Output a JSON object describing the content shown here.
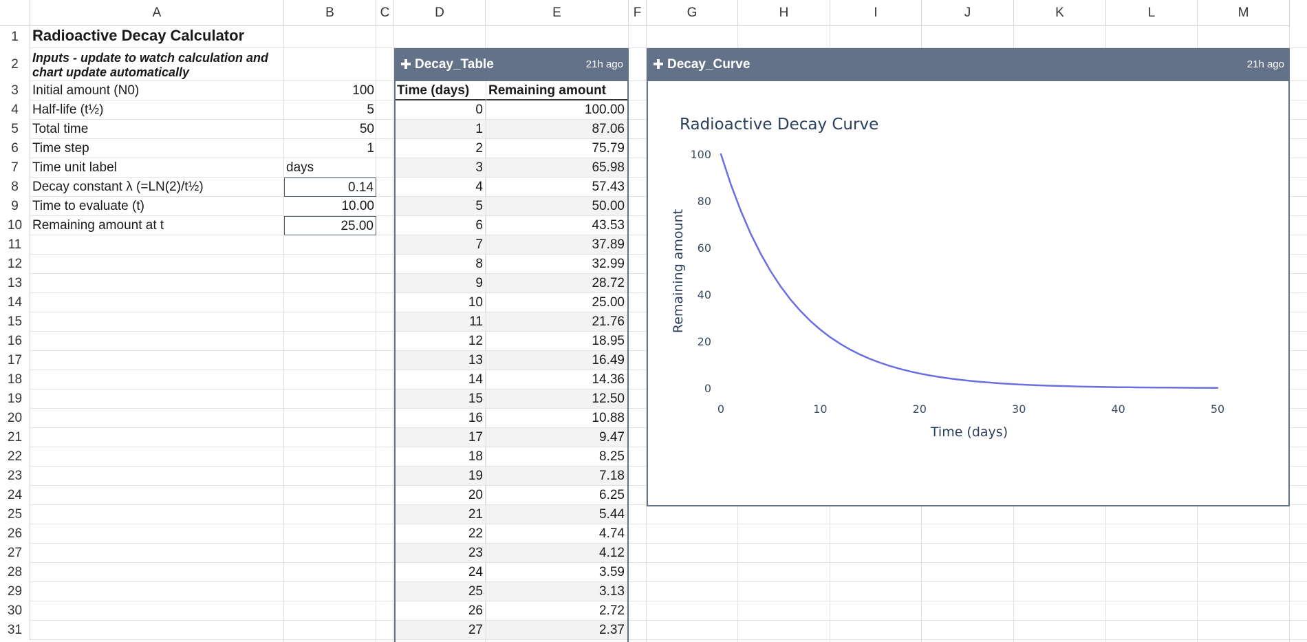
{
  "columns": [
    "A",
    "B",
    "C",
    "D",
    "E",
    "F",
    "G",
    "H",
    "I",
    "J",
    "K",
    "L",
    "M"
  ],
  "rows": [
    "1",
    "2",
    "3",
    "4",
    "5",
    "6",
    "7",
    "8",
    "9",
    "10",
    "11",
    "12",
    "13",
    "14",
    "15",
    "16",
    "17",
    "18",
    "19",
    "20",
    "21",
    "22",
    "23",
    "24",
    "25",
    "26",
    "27",
    "28",
    "29",
    "30",
    "31"
  ],
  "calculator": {
    "title": "Radioactive Decay Calculator",
    "note": "Inputs - update to watch calculation and chart update automatically",
    "params": [
      {
        "label": "Initial amount (N0)",
        "value": "100"
      },
      {
        "label": "Half-life (t½)",
        "value": "5"
      },
      {
        "label": "Total time",
        "value": "50"
      },
      {
        "label": "Time step",
        "value": "1"
      },
      {
        "label": "Time unit label",
        "value": "days"
      },
      {
        "label": "Decay constant λ (=LN(2)/t½)",
        "value": "0.14"
      },
      {
        "label": "Time to evaluate (t)",
        "value": "10.00"
      },
      {
        "label": "Remaining amount at t",
        "value": "25.00"
      }
    ]
  },
  "decay_table": {
    "name": "Decay_Table",
    "updated": "21h ago",
    "headers": [
      "Time (days)",
      "Remaining amount"
    ],
    "rows": [
      [
        "0",
        "100.00"
      ],
      [
        "1",
        "87.06"
      ],
      [
        "2",
        "75.79"
      ],
      [
        "3",
        "65.98"
      ],
      [
        "4",
        "57.43"
      ],
      [
        "5",
        "50.00"
      ],
      [
        "6",
        "43.53"
      ],
      [
        "7",
        "37.89"
      ],
      [
        "8",
        "32.99"
      ],
      [
        "9",
        "28.72"
      ],
      [
        "10",
        "25.00"
      ],
      [
        "11",
        "21.76"
      ],
      [
        "12",
        "18.95"
      ],
      [
        "13",
        "16.49"
      ],
      [
        "14",
        "14.36"
      ],
      [
        "15",
        "12.50"
      ],
      [
        "16",
        "10.88"
      ],
      [
        "17",
        "9.47"
      ],
      [
        "18",
        "8.25"
      ],
      [
        "19",
        "7.18"
      ],
      [
        "20",
        "6.25"
      ],
      [
        "21",
        "5.44"
      ],
      [
        "22",
        "4.74"
      ],
      [
        "23",
        "4.12"
      ],
      [
        "24",
        "3.59"
      ],
      [
        "25",
        "3.13"
      ],
      [
        "26",
        "2.72"
      ],
      [
        "27",
        "2.37"
      ]
    ]
  },
  "decay_curve": {
    "name": "Decay_Curve",
    "updated": "21h ago"
  },
  "colors": {
    "header_bg": "#647289",
    "line": "#6a6ee0",
    "axis_text": "#2b3f5c"
  },
  "chart_data": {
    "type": "line",
    "title": "Radioactive Decay Curve",
    "xlabel": "Time (days)",
    "ylabel": "Remaining amount",
    "xlim": [
      0,
      50
    ],
    "ylim": [
      0,
      100
    ],
    "xticks": [
      0,
      10,
      20,
      30,
      40,
      50
    ],
    "yticks": [
      0,
      20,
      40,
      60,
      80,
      100
    ],
    "grid": false,
    "x": [
      0,
      1,
      2,
      3,
      4,
      5,
      6,
      7,
      8,
      9,
      10,
      11,
      12,
      13,
      14,
      15,
      16,
      17,
      18,
      19,
      20,
      21,
      22,
      23,
      24,
      25,
      26,
      27,
      28,
      29,
      30,
      31,
      32,
      33,
      34,
      35,
      36,
      37,
      38,
      39,
      40,
      41,
      42,
      43,
      44,
      45,
      46,
      47,
      48,
      49,
      50
    ],
    "series": [
      {
        "values": [
          100.0,
          87.06,
          75.79,
          65.98,
          57.43,
          50.0,
          43.53,
          37.89,
          32.99,
          28.72,
          25.0,
          21.76,
          18.95,
          16.49,
          14.36,
          12.5,
          10.88,
          9.47,
          8.25,
          7.18,
          6.25,
          5.44,
          4.74,
          4.12,
          3.59,
          3.13,
          2.72,
          2.37,
          2.06,
          1.8,
          1.56,
          1.36,
          1.18,
          1.03,
          0.9,
          0.78,
          0.68,
          0.59,
          0.52,
          0.45,
          0.39,
          0.34,
          0.3,
          0.26,
          0.22,
          0.2,
          0.17,
          0.15,
          0.13,
          0.11,
          0.1
        ]
      }
    ]
  }
}
